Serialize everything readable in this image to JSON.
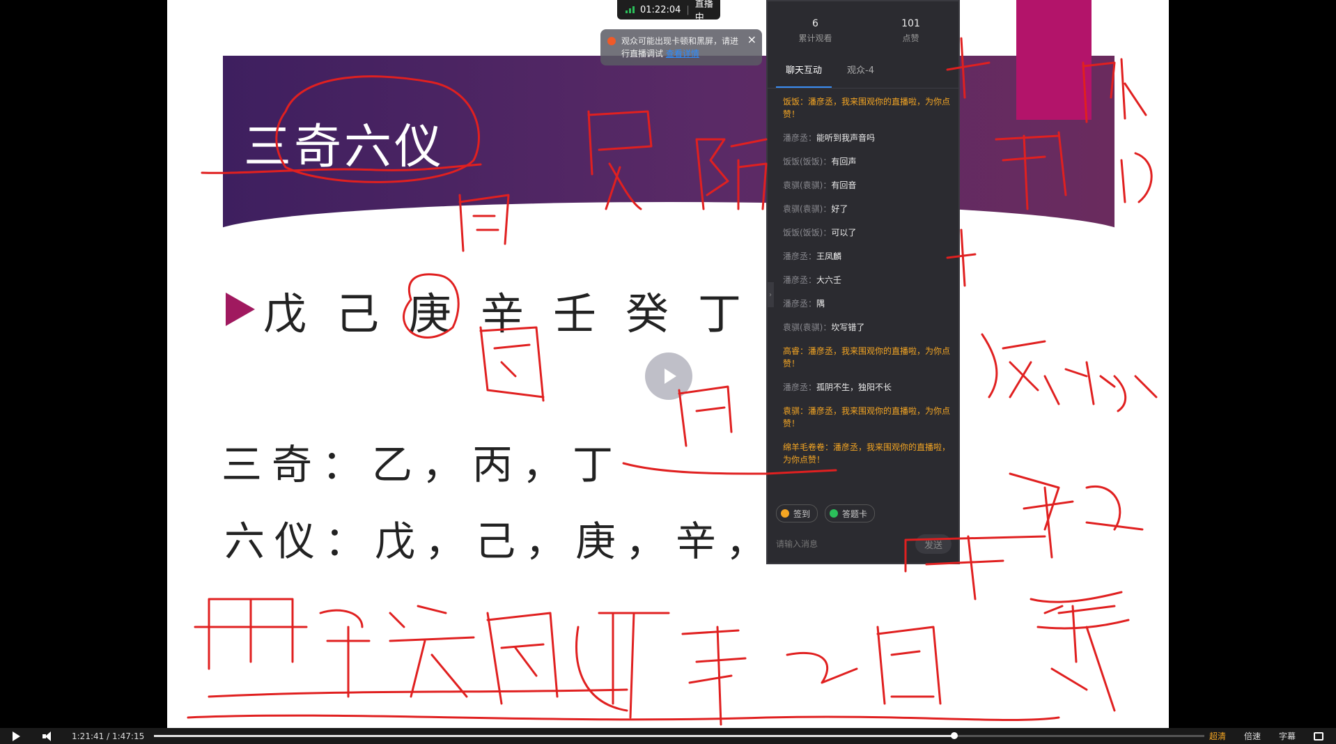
{
  "slide": {
    "title": "三奇六仪",
    "stems": "戊己庚辛壬癸丁",
    "sanqi": "三奇：乙，丙，丁",
    "liuyi": "六仪：戊，己，庚，辛，"
  },
  "live": {
    "timer": "01:22:04",
    "status": "直播中",
    "notice_text": "观众可能出现卡顿和黑屏，请进行直播调试",
    "notice_link": "查看详情"
  },
  "panel": {
    "stats": [
      {
        "value": "6",
        "label": "累计观看"
      },
      {
        "value": "101",
        "label": "点赞"
      }
    ],
    "tabs": [
      {
        "label": "聊天互动"
      },
      {
        "label": "观众-4"
      }
    ],
    "messages": [
      {
        "name": "饭饭：",
        "text": "潘彦丞，我来围观你的直播啦，为你点赞！",
        "system": true
      },
      {
        "name": "潘彦丞：",
        "text": "能听到我声音吗",
        "system": false
      },
      {
        "name": "饭饭(饭饭)：",
        "text": "有回声",
        "system": false
      },
      {
        "name": "袁骐(袁骐)：",
        "text": "有回音",
        "system": false
      },
      {
        "name": "袁骐(袁骐)：",
        "text": "好了",
        "system": false
      },
      {
        "name": "饭饭(饭饭)：",
        "text": "可以了",
        "system": false
      },
      {
        "name": "潘彦丞：",
        "text": "王凤麟",
        "system": false
      },
      {
        "name": "潘彦丞：",
        "text": "大六壬",
        "system": false
      },
      {
        "name": "潘彦丞：",
        "text": "隅",
        "system": false
      },
      {
        "name": "袁骐(袁骐)：",
        "text": "坎写错了",
        "system": false
      },
      {
        "name": "高睿：",
        "text": "潘彦丞，我来围观你的直播啦，为你点赞！",
        "system": true
      },
      {
        "name": "潘彦丞：",
        "text": "孤阴不生，独阳不长",
        "system": false
      },
      {
        "name": "袁骐：",
        "text": "潘彦丞，我来围观你的直播啦，为你点赞！",
        "system": true
      },
      {
        "name": "绵羊毛卷卷：",
        "text": "潘彦丞，我来围观你的直播啦，为你点赞！",
        "system": true
      }
    ],
    "actions": [
      {
        "label": "签到",
        "color": "#f5a623"
      },
      {
        "label": "答题卡",
        "color": "#2bbf5a"
      }
    ],
    "input_placeholder": "请输入消息",
    "send_label": "发送"
  },
  "player": {
    "current_time": "1:21:41",
    "separator": "/",
    "duration": "1:47:15",
    "progress_fraction": 0.7616,
    "quality_label": "超清",
    "speed_label": "倍速",
    "subtitle_label": "字幕"
  }
}
